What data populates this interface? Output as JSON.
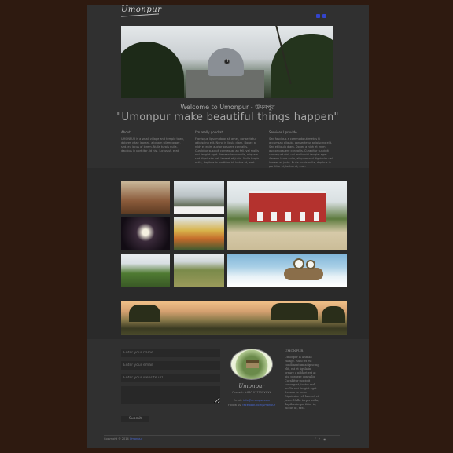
{
  "header": {
    "logo_text": "Umonpur",
    "icons": [
      "facebook-icon",
      "twitter-icon"
    ]
  },
  "hero": {
    "slide_indicator": "II"
  },
  "intro": {
    "welcome": "Welcome to Umonpur - উমনপুর",
    "tagline": "\"Umonpur make beautiful things happen\""
  },
  "columns": [
    {
      "heading": "About...",
      "text": "UMONPUR is a small village and temple town, dolores vitae laoreat, aliquam ullamcorper, sed, eu lacus of lorem. Nulla turpis nulla, dapibus in porttitor, id nisl, luctus ut, erat."
    },
    {
      "heading": "I'm really good at...",
      "text": "Fronisque lipsum dolor sit amet, consectetur adipiscing elit. Nunc in ligula diam. Donec a nibh et enim auctor posuere convallis. Curabitur suscipit consequat an feli, vel mollis nisi feugiat eget. Aenean lacus nulla, aliquam sed dignissim vel, laoreet et justo. Nulla turpis nulla, dapibus in porttitor id, luctus ut, erat."
    },
    {
      "heading": "Services I provide...",
      "text": "Sed faucibus a commodo ut metus hi accumsan aliquip, consectetur adipiscing elit. Sed et ligula diam. Donec a nibh et enim auctor posuere convallis. Curabitur suscipit consequat nisi, vel mollis nisi feugiat eget. Aenean lacus nulla, aliquam sed dignissim vel, laoreet et justo. Nulla turpis nulla, dapibus in porttitor id, luctus ut, erat."
    }
  ],
  "contact_form": {
    "name_placeholder": "Enter your name",
    "email_placeholder": "Enter your email",
    "website_placeholder": "Enter your website url",
    "message_placeholder": "",
    "submit_label": "Submit"
  },
  "badge": {
    "title": "Umonpur",
    "line1": "Contact: +880 01770XXXXX",
    "line2_label": "Email: ",
    "line2_link": "info@umonpur.com",
    "line3_label": "Follow us: ",
    "line3_link": "facebook.com/umonpur"
  },
  "about_footer": {
    "heading": "UMONPUR",
    "text": "Umonpur is a small village. Nunc et est condimentum adipiscing elit, est et ligula in ornare a nibh et est at nisl posuere convallis. Curabitur suscipit consequat, tortor sed mollis nisi feugiat eget. Aenean in lacus. Dignissim vel, laoreet et justo. Nulla turpis nulla, dapibus in porttitor id, luctus ut, erat."
  },
  "footer": {
    "copyright_prefix": "Copyright © 2014",
    "copyright_link": "Umonpur",
    "social_icons": [
      "facebook-icon",
      "twitter-icon",
      "rss-icon"
    ]
  },
  "colors": {
    "background": "#2e1a10",
    "page": "#303030",
    "link": "#4a6ad8"
  }
}
